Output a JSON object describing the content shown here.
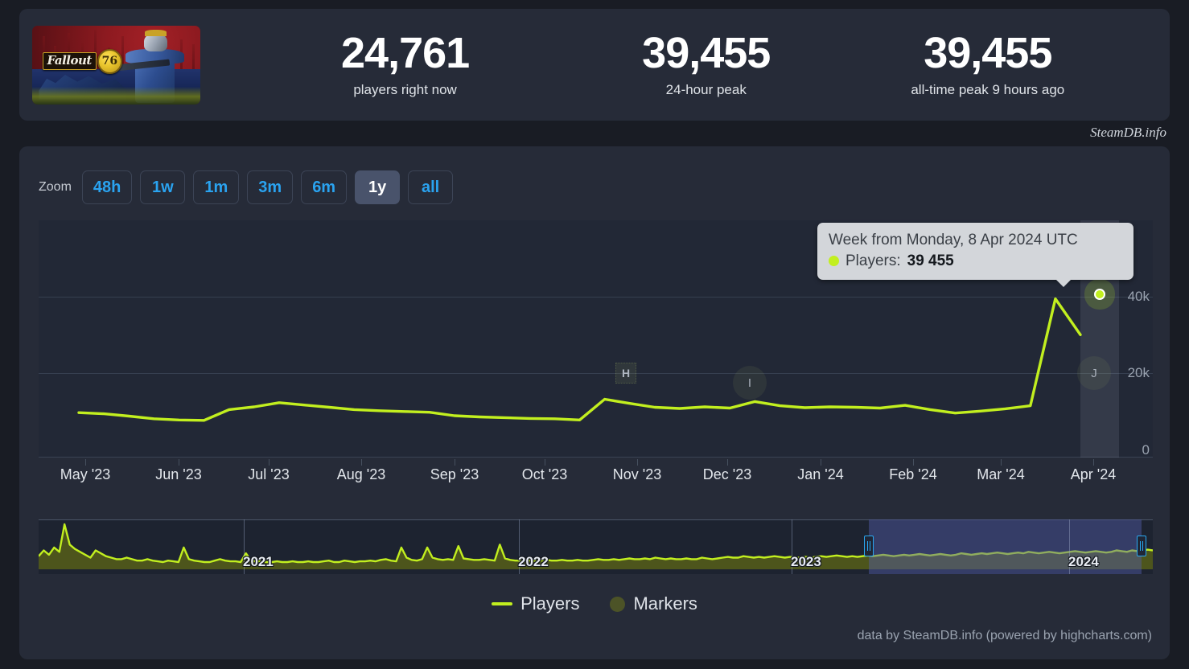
{
  "header": {
    "game_title": "Fallout 76",
    "capsule_logo_text": "Fallout",
    "capsule_logo_number": "76",
    "stats": [
      {
        "name": "players-right-now",
        "value": "24,761",
        "label": "players right now"
      },
      {
        "name": "24-hour-peak",
        "value": "39,455",
        "label": "24-hour peak"
      },
      {
        "name": "all-time-peak",
        "value": "39,455",
        "label": "all-time peak 9 hours ago"
      }
    ],
    "brand_credit": "SteamDB.info"
  },
  "chart_controls": {
    "zoom_label": "Zoom",
    "buttons": [
      {
        "label": "48h",
        "active": false
      },
      {
        "label": "1w",
        "active": false
      },
      {
        "label": "1m",
        "active": false
      },
      {
        "label": "3m",
        "active": false
      },
      {
        "label": "6m",
        "active": false
      },
      {
        "label": "1y",
        "active": true
      },
      {
        "label": "all",
        "active": false
      }
    ]
  },
  "tooltip": {
    "title": "Week from Monday, 8 Apr 2024 UTC",
    "series_label": "Players:",
    "series_value": "39 455",
    "marker_color": "#c2ef1f"
  },
  "chart_markers": [
    {
      "name": "marker-flag-h",
      "label": "H",
      "shape": "square"
    },
    {
      "name": "marker-circle-i",
      "label": "I",
      "shape": "circle"
    },
    {
      "name": "marker-circle-j",
      "label": "J",
      "shape": "circle"
    }
  ],
  "legend": {
    "position": "bottom-center",
    "items": [
      {
        "name": "legend-players",
        "label": "Players",
        "color": "#c2ef1f",
        "symbol": "line"
      },
      {
        "name": "legend-markers",
        "label": "Markers",
        "color": "#4c5327",
        "symbol": "dot"
      }
    ]
  },
  "navigator": {
    "year_labels": [
      "2021",
      "2022",
      "2023",
      "2024"
    ],
    "selection_start_pct": 74.5,
    "selection_end_pct": 99.0
  },
  "footer": {
    "credit": "data by SteamDB.info (powered by highcharts.com)"
  },
  "colors": {
    "page_background": "#191c24",
    "card_background": "#262b38",
    "plot_background": "#222836",
    "navigator_background": "#1d2330",
    "series_line": "#c2ef1f",
    "accent_blue": "#2aa3f0",
    "active_button": "#49536b",
    "navigator_selection": "#545eaa",
    "handle_border": "#29a8f2"
  },
  "chart_data": {
    "type": "line",
    "title": "Fallout 76 concurrent players",
    "xlabel": "",
    "ylabel": "Players",
    "ylim": [
      0,
      45000
    ],
    "yticks": [
      0,
      20000,
      40000
    ],
    "ytick_labels": [
      "0",
      "20k",
      "40k"
    ],
    "grid": true,
    "legend_position": "bottom",
    "xticks": [
      "May '23",
      "Jun '23",
      "Jul '23",
      "Aug '23",
      "Sep '23",
      "Oct '23",
      "Nov '23",
      "Dec '23",
      "Jan '24",
      "Feb '24",
      "Mar '24",
      "Apr '24"
    ],
    "series": [
      {
        "name": "Players",
        "color": "#c2ef1f",
        "x": [
          "2023-05-01",
          "2023-05-15",
          "2023-05-29",
          "2023-06-12",
          "2023-06-19",
          "2023-06-26",
          "2023-07-03",
          "2023-07-10",
          "2023-07-17",
          "2023-07-24",
          "2023-07-31",
          "2023-08-14",
          "2023-08-28",
          "2023-09-04",
          "2023-09-11",
          "2023-09-18",
          "2023-09-25",
          "2023-10-09",
          "2023-10-16",
          "2023-10-23",
          "2023-10-30",
          "2023-11-06",
          "2023-11-13",
          "2023-11-20",
          "2023-11-27",
          "2023-12-04",
          "2023-12-11",
          "2023-12-18",
          "2023-12-25",
          "2024-01-01",
          "2024-01-08",
          "2024-01-15",
          "2024-01-29",
          "2024-02-05",
          "2024-02-19",
          "2024-03-04",
          "2024-03-18",
          "2024-03-25",
          "2024-04-01",
          "2024-04-08",
          "2024-04-15"
        ],
        "values": [
          9800,
          9500,
          8900,
          8200,
          7900,
          7800,
          10600,
          11300,
          12400,
          11800,
          11200,
          10600,
          10300,
          10100,
          9900,
          9000,
          8700,
          8500,
          8300,
          8200,
          7900,
          13300,
          12200,
          11200,
          10900,
          11300,
          11000,
          12700,
          11600,
          11100,
          11300,
          11200,
          11000,
          11700,
          10600,
          9700,
          10200,
          10800,
          11600,
          39455,
          30100
        ]
      }
    ],
    "highlighted_point": {
      "x": "2024-04-08",
      "y": 39455,
      "label": "39 455"
    },
    "navigator_series": {
      "name": "Players",
      "type": "area",
      "color": "#c2ef1f",
      "span": [
        "2020-05",
        "2024-04"
      ]
    }
  }
}
